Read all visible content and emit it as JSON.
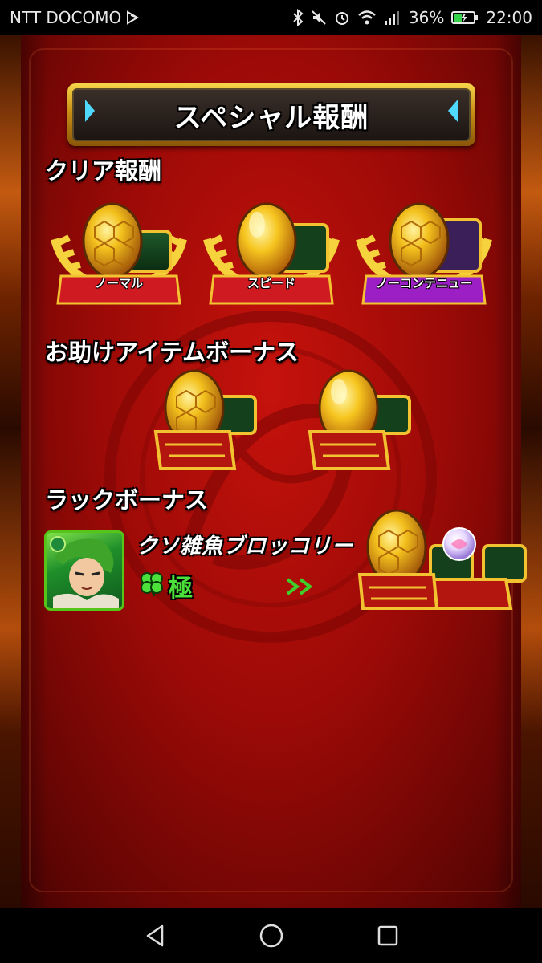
{
  "status_bar": {
    "carrier": "NTT DOCOMO",
    "battery": "36%",
    "time": "22:00"
  },
  "title": "スペシャル報酬",
  "sections": {
    "clear_reward": "クリア報酬",
    "helper_bonus": "お助けアイテムボーナス",
    "luck_bonus": "ラックボーナス"
  },
  "clear_rewards": [
    {
      "label": "ノーマル",
      "ribbon_color": "#d01a22"
    },
    {
      "label": "スピード",
      "ribbon_color": "#d01a22"
    },
    {
      "label": "ノーコンテニュー",
      "ribbon_color": "#9b1fc4"
    }
  ],
  "luck": {
    "monster_name": "クソ雑魚ブロッコリー",
    "level": "極"
  },
  "colors": {
    "background": "#b00d09",
    "gold": "#f2c230",
    "luck_green": "#4be03a"
  },
  "icons": [
    "golden-egg-icon",
    "treasure-chest-icon",
    "laurel-icon",
    "clover-icon",
    "arrow-icon",
    "orb-icon"
  ]
}
